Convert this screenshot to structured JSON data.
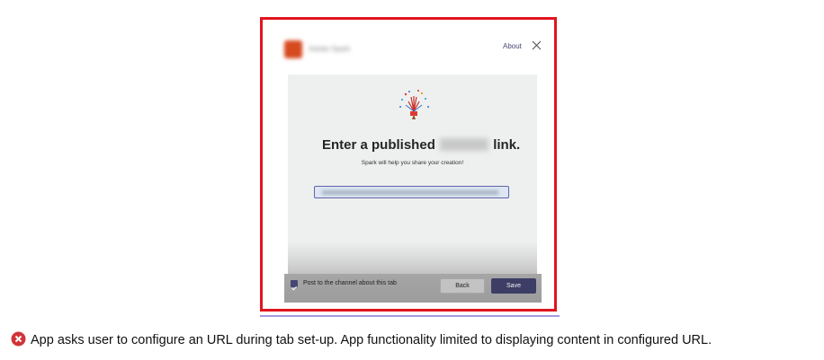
{
  "dialog": {
    "app_name": "Adobe Spark",
    "about_link": "About",
    "headline_before": "Enter a published",
    "headline_hidden_word": "Spark",
    "headline_after": "link.",
    "subtext": "Spark will help you share your creation!",
    "url_value": "https://spark.adobe.com/page/example-link",
    "post_checkbox_checked": true,
    "post_checkbox_label": "Post to the channel about this tab",
    "back_label": "Back",
    "save_label": "Save"
  },
  "caption": {
    "icon": "error-icon",
    "text": "App asks user to configure an URL during tab set-up. App functionality limited to displaying content in configured URL."
  },
  "colors": {
    "frame_border": "#e1141e",
    "accent": "#464775",
    "save_button": "#3d3e66",
    "error": "#d13438"
  }
}
